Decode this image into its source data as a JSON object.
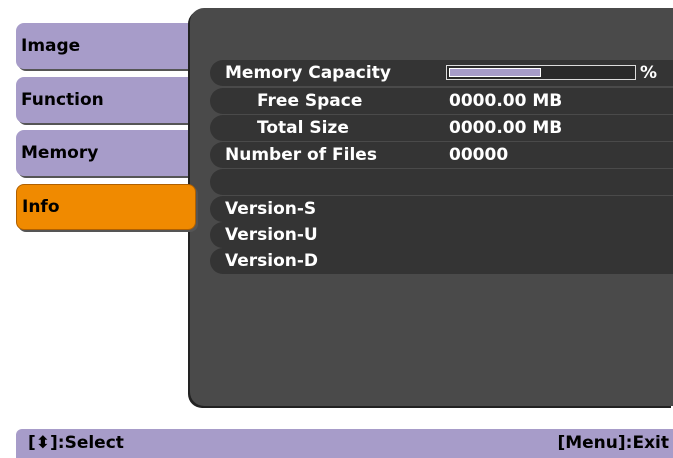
{
  "menu": {
    "tabs": [
      {
        "label": "Image",
        "active": false
      },
      {
        "label": "Function",
        "active": false
      },
      {
        "label": "Memory",
        "active": false
      },
      {
        "label": "Info",
        "active": true
      }
    ]
  },
  "info": {
    "memory_capacity": {
      "label": "Memory Capacity",
      "unit": "%",
      "fill_fraction": 0.5
    },
    "free_space": {
      "label": "Free Space",
      "value": "0000.00 MB"
    },
    "total_size": {
      "label": "Total Size",
      "value": "0000.00 MB"
    },
    "number_of_files": {
      "label": "Number of Files",
      "value": "00000"
    },
    "version_s": {
      "label": "Version-S"
    },
    "version_u": {
      "label": "Version-U"
    },
    "version_d": {
      "label": "Version-D"
    }
  },
  "footer": {
    "select_hint": "[⬍]:Select",
    "exit_hint": "[Menu]:Exit"
  },
  "colors": {
    "tab": "#a79cc9",
    "active_tab": "#f08a00",
    "panel": "#4a4a4a",
    "row": "#343434"
  }
}
